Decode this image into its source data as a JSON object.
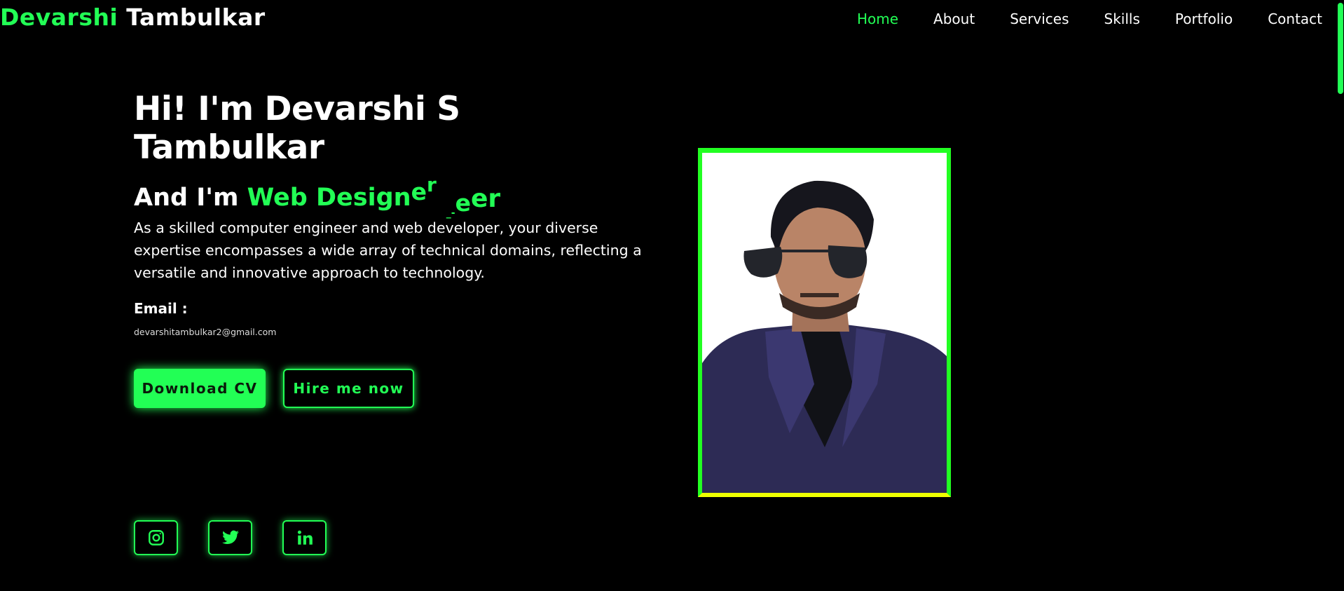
{
  "header": {
    "logo_first": "Devarshi",
    "logo_last": "Tambulkar",
    "nav": [
      {
        "label": "Home"
      },
      {
        "label": "About"
      },
      {
        "label": "Services"
      },
      {
        "label": "Skills"
      },
      {
        "label": "Portfolio"
      },
      {
        "label": "Contact"
      }
    ]
  },
  "hero": {
    "greeting": "Hi! I'm Devarshi S Tambulkar",
    "role_prefix": "And I'm",
    "role_text": "Web Design",
    "role_tail": [
      "e",
      "r",
      "_-",
      "e",
      "er"
    ],
    "description": "As a skilled computer engineer and web developer, your diverse expertise encompasses a wide array of technical domains, reflecting a versatile and innovative approach to technology.",
    "email_label": "Email :",
    "email_value": "devarshitambulkar2@gmail.com",
    "download_cv_label": "Download CV",
    "hire_me_label": "Hire me now"
  },
  "socials": [
    {
      "icon": "instagram-icon"
    },
    {
      "icon": "twitter-icon"
    },
    {
      "icon": "linkedin-icon"
    }
  ],
  "colors": {
    "accent": "#22ff55",
    "background": "#000000",
    "frame_border": "#22ff22",
    "frame_bottom": "#eeff00"
  }
}
